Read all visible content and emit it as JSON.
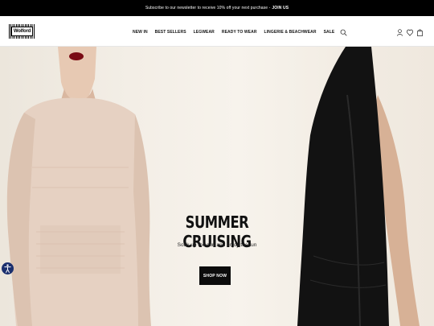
{
  "announcement": {
    "text": "Subscribe to our newsletter to receive 10% off your next purchase -",
    "cta": "JOIN US"
  },
  "header": {
    "logo_text": "Wolford",
    "nav": [
      "NEW IN",
      "BEST SELLERS",
      "LEGWEAR",
      "READY TO WEAR",
      "LINGERIE & BEACHWEAR",
      "SALE"
    ],
    "icons": [
      "search-icon",
      "account-icon",
      "wishlist-icon",
      "bag-icon"
    ]
  },
  "hero": {
    "title": "SUMMER CRUISING",
    "subtitle": "Soak up the sun and enjoy the fun",
    "button_label": "SHOP NOW"
  },
  "colors": {
    "announcement_bg": "#000000",
    "button_bg": "#0c0c0c",
    "hero_bg": "#f3eee6",
    "accessibility_badge": "#1b2f6e"
  }
}
